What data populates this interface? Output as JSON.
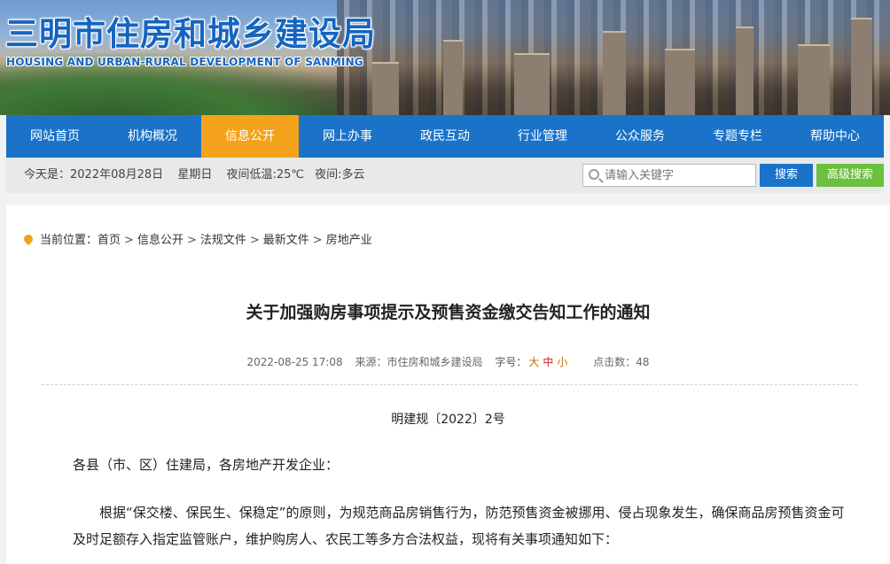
{
  "header": {
    "title": "三明市住房和城乡建设局",
    "subtitle": "HOUSING AND URBAN-RURAL DEVELOPMENT OF SANMING"
  },
  "nav": {
    "items": [
      {
        "label": "网站首页"
      },
      {
        "label": "机构概况"
      },
      {
        "label": "信息公开",
        "active": true
      },
      {
        "label": "网上办事"
      },
      {
        "label": "政民互动"
      },
      {
        "label": "行业管理"
      },
      {
        "label": "公众服务"
      },
      {
        "label": "专题专栏"
      },
      {
        "label": "帮助中心"
      }
    ]
  },
  "infobar": {
    "today": "今天是：2022年08月28日",
    "weekday": "星期日",
    "low_temp": "夜间低温:25℃",
    "night": "夜间:多云",
    "search_placeholder": "请输入关键字",
    "search_label": "搜索",
    "advanced_label": "高级搜索"
  },
  "breadcrumb": {
    "prefix": "当前位置：",
    "items": [
      "首页",
      "信息公开",
      "法规文件",
      "最新文件",
      "房地产业"
    ],
    "sep": ">"
  },
  "article": {
    "title": "关于加强购房事项提示及预售资金缴交告知工作的通知",
    "date": "2022-08-25 17:08",
    "source": "来源：市住房和城乡建设局",
    "font_label": "字号：",
    "font_sizes": [
      "大",
      "中",
      "小"
    ],
    "hits": "点击数：48",
    "doc_no": "明建规〔2022〕2号",
    "addressee": "各县（市、区）住建局，各房地产开发企业：",
    "paragraph": "根据“保交楼、保民生、保稳定”的原则，为规范商品房销售行为，防范预售资金被挪用、侵占现象发生，确保商品房预售资金可及时足额存入指定监管账户，维护购房人、农民工等多方合法权益，现将有关事项通知如下："
  },
  "colors": {
    "nav_blue": "#1a73c8",
    "nav_active": "#f4a21c",
    "advanced_green": "#6cbf3f"
  }
}
